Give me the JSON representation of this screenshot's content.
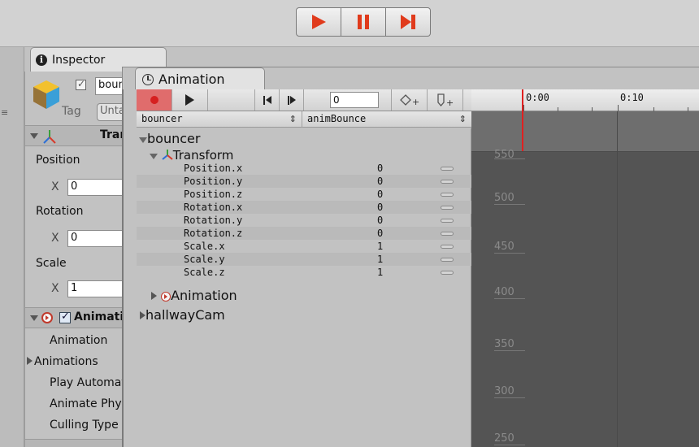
{
  "toolbar": {
    "play_icon": "play-icon",
    "pause_icon": "pause-icon",
    "step_icon": "step-icon"
  },
  "inspector": {
    "tab_label": "Inspector",
    "object_name": "bouncer",
    "tag_label": "Tag",
    "tag_value": "Untagged",
    "transform": {
      "title": "Transform",
      "position_label": "Position",
      "rotation_label": "Rotation",
      "scale_label": "Scale",
      "x_label": "X",
      "position_x": "0",
      "rotation_x": "0",
      "scale_x": "1"
    },
    "animation_component": {
      "title": "Animation",
      "fields": [
        "Animation",
        "Animations",
        "Play Automatically",
        "Animate Physics",
        "Culling Type"
      ]
    }
  },
  "animation": {
    "tab_label": "Animation",
    "frame_value": "0",
    "object_selector": "bouncer",
    "clip_selector": "animBounce",
    "tree": {
      "root": "bouncer",
      "transform": "Transform",
      "animation": "Animation",
      "camera": "hallwayCam"
    },
    "properties": [
      {
        "name": "Position.x",
        "value": "0"
      },
      {
        "name": "Position.y",
        "value": "0"
      },
      {
        "name": "Position.z",
        "value": "0"
      },
      {
        "name": "Rotation.x",
        "value": "0"
      },
      {
        "name": "Rotation.y",
        "value": "0"
      },
      {
        "name": "Rotation.z",
        "value": "0"
      },
      {
        "name": "Scale.x",
        "value": "1"
      },
      {
        "name": "Scale.y",
        "value": "1"
      },
      {
        "name": "Scale.z",
        "value": "1"
      }
    ],
    "timeline": {
      "ruler_labels": [
        "0:00",
        "0:10"
      ],
      "y_labels": [
        "550",
        "500",
        "450",
        "400",
        "350",
        "300",
        "250"
      ]
    }
  },
  "colors": {
    "record_active": "#e06c6c",
    "playhead": "#e02020",
    "play_red": "#e03b1c",
    "curve_bg": "#545454"
  }
}
